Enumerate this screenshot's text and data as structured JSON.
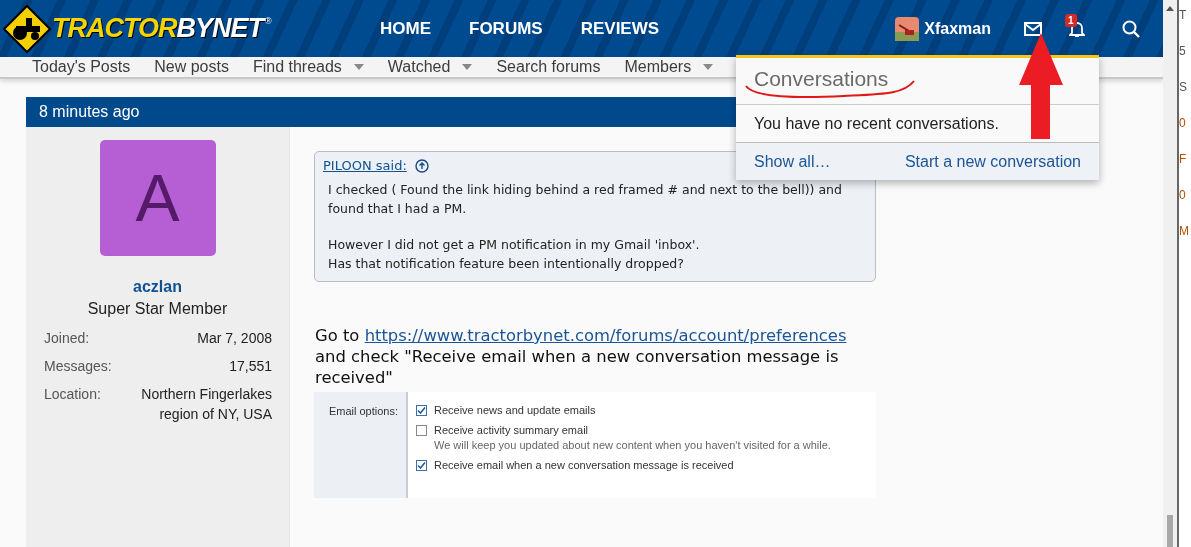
{
  "header": {
    "logo": {
      "text_1": "TRACTOR",
      "text_2": "BYNET",
      "mark": "®"
    },
    "nav": [
      {
        "label": "HOME"
      },
      {
        "label": "FORUMS"
      },
      {
        "label": "REVIEWS"
      }
    ],
    "user": {
      "name": "Xfaxman"
    },
    "alerts": {
      "badge": "1"
    }
  },
  "subnav": [
    {
      "label": "Today's Posts",
      "dropdown": false
    },
    {
      "label": "New posts",
      "dropdown": false
    },
    {
      "label": "Find threads",
      "dropdown": true
    },
    {
      "label": "Watched",
      "dropdown": true
    },
    {
      "label": "Search forums",
      "dropdown": false
    },
    {
      "label": "Members",
      "dropdown": true
    }
  ],
  "post": {
    "time": "8 minutes ago",
    "author": {
      "initial": "A",
      "name": "aczlan",
      "title": "Super Star Member",
      "stats": [
        {
          "label": "Joined:",
          "value": "Mar 7, 2008"
        },
        {
          "label": "Messages:",
          "value": "17,551"
        },
        {
          "label": "Location:",
          "value": "Northern Fingerlakes region of NY, USA"
        }
      ]
    },
    "quote": {
      "author": "PILOON said:",
      "paragraphs": [
        "I checked ( Found the link hiding behind a red framed # and next to the bell)) and found that I had a PM.",
        "However I did not get a PM notification in my Gmail 'inbox'.\nHas that notification feature been intentionally dropped?"
      ]
    },
    "body": {
      "before": "Go to",
      "link": "https://www.tractorbynet.com/forums/account/preferences",
      "after": "and check \"Receive email when a new conversation message is received\""
    },
    "screenshot": {
      "label": "Email options:",
      "options": [
        {
          "label": "Receive news and update emails",
          "checked": true
        },
        {
          "label": "Receive activity summary email",
          "hint": "We will keep you updated about new content when you haven't visited for a while.",
          "checked": false
        },
        {
          "label": "Receive email when a new conversation message is received",
          "checked": true
        }
      ]
    }
  },
  "popup": {
    "title": "Conversations",
    "message": "You have no recent conversations.",
    "links": [
      "Show all…",
      "Start a new conversation"
    ]
  },
  "other_window": {
    "fragments": [
      "T",
      "5",
      "S",
      "0",
      "F",
      "0",
      "M"
    ]
  }
}
